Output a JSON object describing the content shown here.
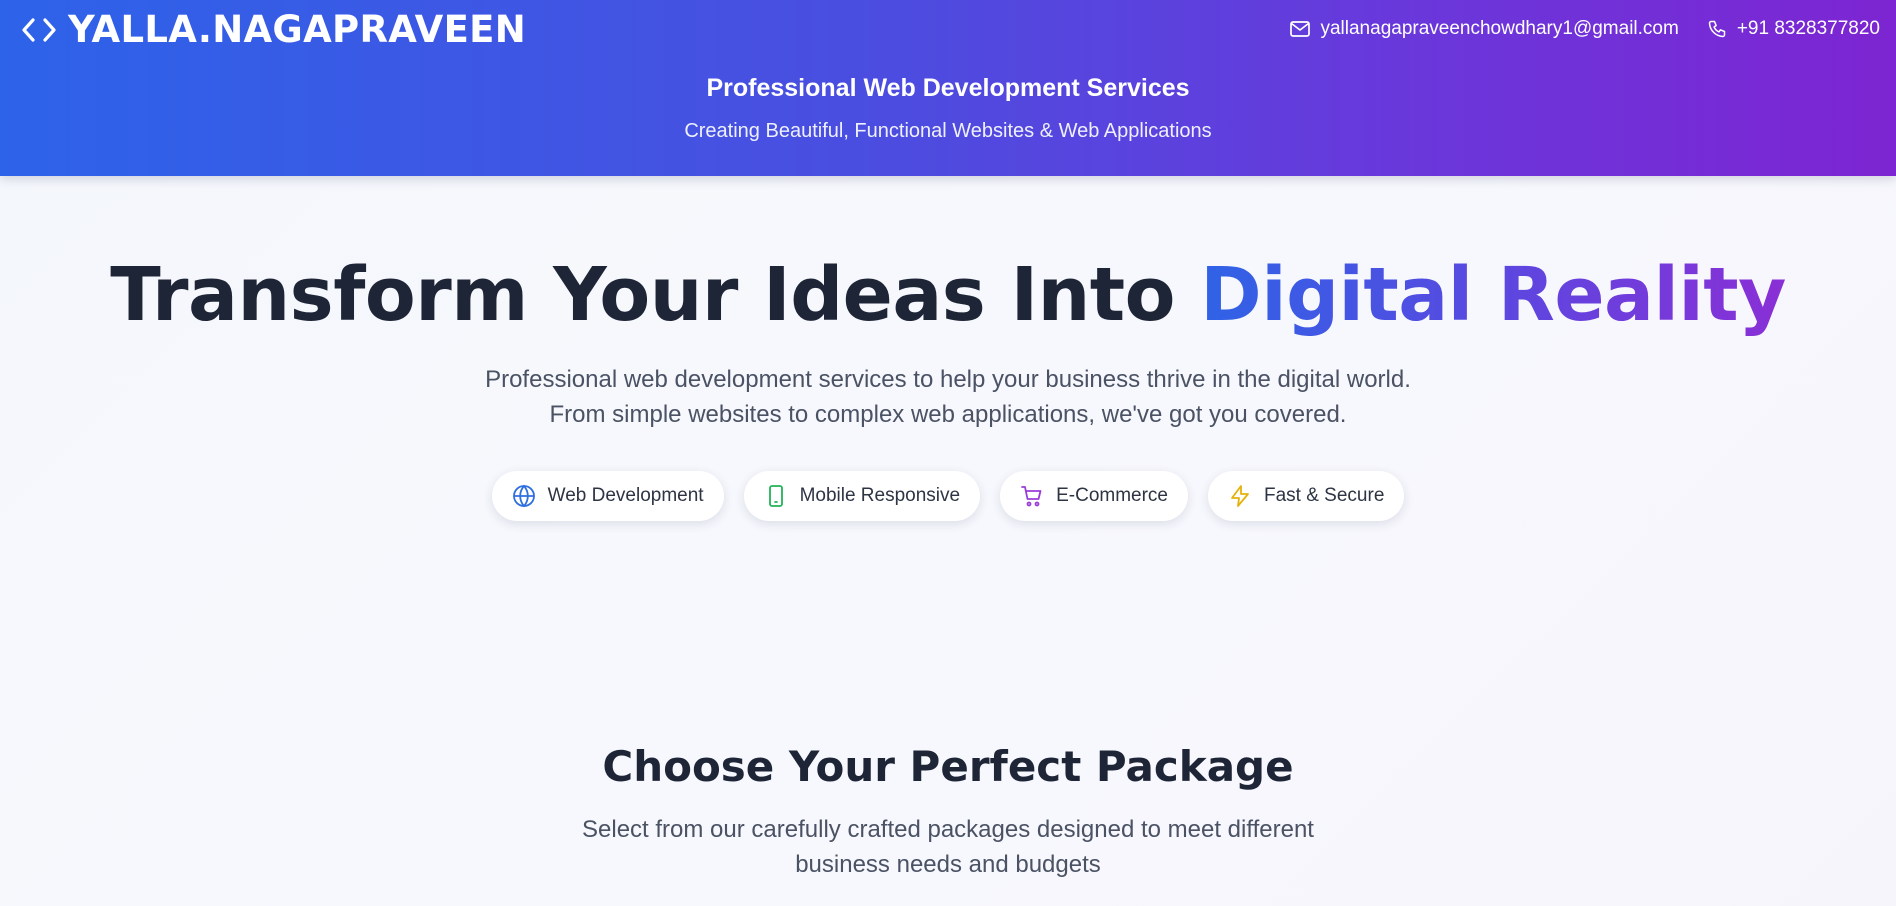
{
  "header": {
    "brand_name": "YALLA.NAGAPRAVEEN",
    "brand_icon": "code-icon",
    "email": "yallanagapraveenchowdhary1@gmail.com",
    "phone": "+91 8328377820",
    "title": "Professional Web Development Services",
    "subtitle": "Creating Beautiful, Functional Websites & Web Applications"
  },
  "hero": {
    "title_plain": "Transform Your Ideas Into",
    "title_accent": "Digital Reality",
    "description": "Professional web development services to help your business thrive in the digital world. From simple websites to complex web applications, we've got you covered.",
    "pills": [
      {
        "label": "Web Development",
        "icon": "globe-icon",
        "color": "#2f6fe0"
      },
      {
        "label": "Mobile Responsive",
        "icon": "smartphone-icon",
        "color": "#22b35a"
      },
      {
        "label": "E-Commerce",
        "icon": "cart-icon",
        "color": "#9a3cd6"
      },
      {
        "label": "Fast & Secure",
        "icon": "lightning-icon",
        "color": "#e5b20d"
      }
    ]
  },
  "packages": {
    "title": "Choose Your Perfect Package",
    "description": "Select from our carefully crafted packages designed to meet different business needs and budgets"
  },
  "colors": {
    "header_gradient_start": "#2d63e9",
    "header_gradient_end": "#7d25d2",
    "heading_dark": "#1e2536",
    "body_text": "#4a5264"
  }
}
